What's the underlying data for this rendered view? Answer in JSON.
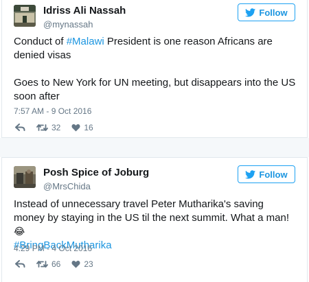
{
  "tweets": [
    {
      "author_name": "Idriss Ali Nassah",
      "handle": "@mynassah",
      "follow_label": "Follow",
      "text": {
        "p1_before": "Conduct of ",
        "p1_link": "#Malawi",
        "p1_after": " President is one reason Africans are denied visas",
        "p2": "Goes to New York for UN meeting, but disappears into the US soon after"
      },
      "timestamp": "7:57 AM - 9 Oct 2016",
      "retweets": "32",
      "likes": "16"
    },
    {
      "author_name": "Posh Spice of Joburg",
      "handle": "@MrsChida",
      "follow_label": "Follow",
      "text": {
        "p1_before": "Instead of unnecessary travel Peter Mutharika's saving money by staying in the US til the next summit. What a man! ",
        "emoji": "😂",
        "p1_link": "#BringBackMutharika"
      },
      "timestamp": "4:29 PM - 4 Oct 2016",
      "retweets": "66",
      "likes": "23"
    }
  ],
  "colors": {
    "accent": "#1b95e0",
    "text": "#14171a",
    "muted": "#657786",
    "border": "#e1e8ed",
    "gap_background": "#f5f8fa"
  },
  "icons": [
    "reply-icon",
    "retweet-icon",
    "heart-icon",
    "twitter-bird-icon"
  ]
}
